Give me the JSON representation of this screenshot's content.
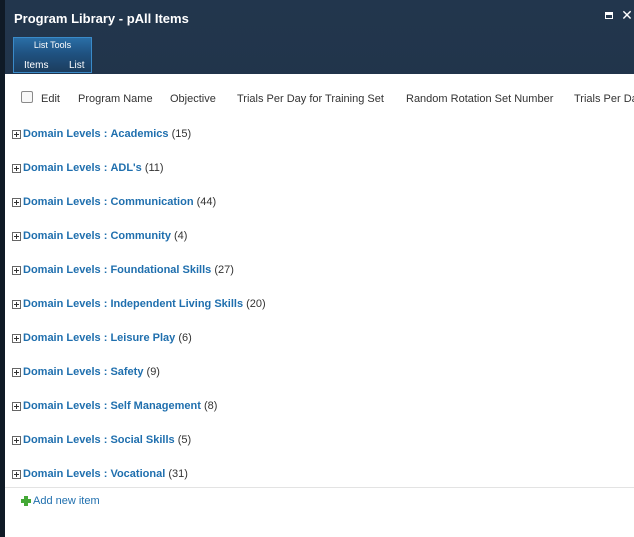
{
  "window": {
    "title": "Program Library - pAll Items",
    "maximize_icon": "maximize-icon",
    "close_label": "✕"
  },
  "ribbon": {
    "context_group": "List Tools",
    "tabs": [
      "Items",
      "List"
    ]
  },
  "list": {
    "columns": [
      "Edit",
      "Program Name",
      "Objective",
      "Trials Per Day for Training Set",
      "Random Rotation Set Number",
      "Trials Per Da"
    ],
    "group_field": "Domain Levels",
    "group_separator": ":",
    "groups": [
      {
        "value": "Academics",
        "count": "(15)"
      },
      {
        "value": "ADL's",
        "count": "(11)"
      },
      {
        "value": "Communication",
        "count": "(44)"
      },
      {
        "value": "Community",
        "count": "(4)"
      },
      {
        "value": "Foundational Skills",
        "count": "(27)"
      },
      {
        "value": "Independent Living Skills",
        "count": "(20)"
      },
      {
        "value": "Leisure Play",
        "count": "(6)"
      },
      {
        "value": "Safety",
        "count": "(9)"
      },
      {
        "value": "Self Management",
        "count": "(8)"
      },
      {
        "value": "Social Skills",
        "count": "(5)"
      },
      {
        "value": "Vocational",
        "count": "(31)"
      }
    ],
    "add_new_item": "Add new item"
  }
}
